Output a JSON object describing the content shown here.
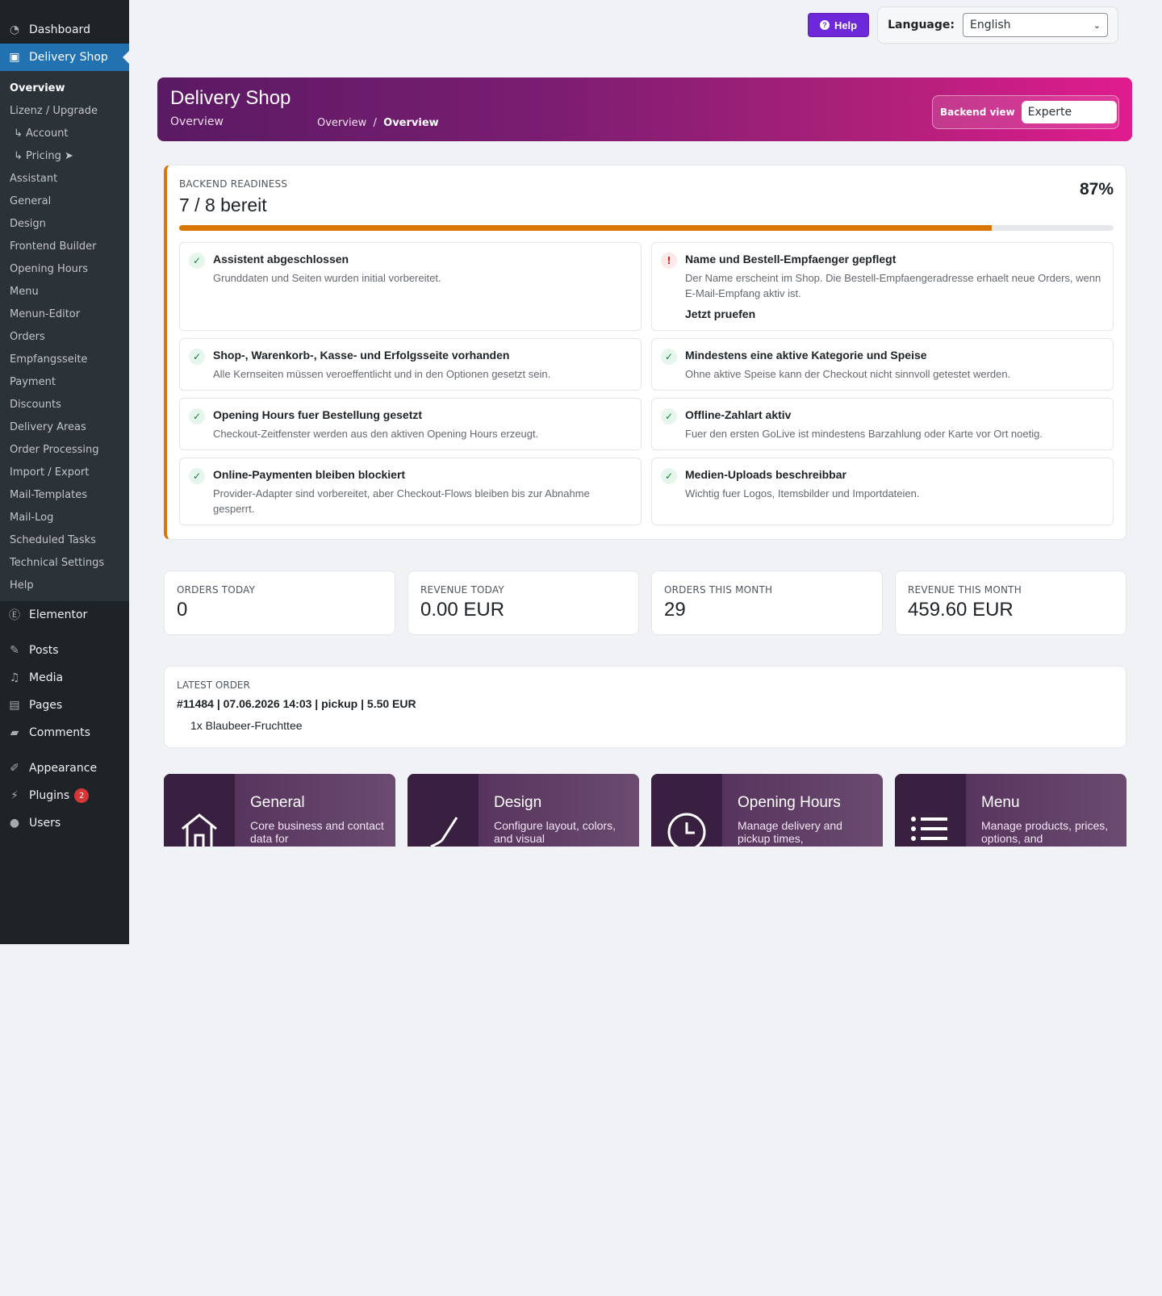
{
  "sidebar": {
    "top_items": [
      {
        "label": "Dashboard",
        "icon": "dashboard-icon"
      },
      {
        "label": "Delivery Shop",
        "icon": "shop-bag-icon"
      }
    ],
    "sub_items": [
      "Overview",
      "Lizenz / Upgrade",
      "↳ Account",
      "↳ Pricing ➤",
      "Assistant",
      "General",
      "Design",
      "Frontend Builder",
      "Opening Hours",
      "Menu",
      "Menun-Editor",
      "Orders",
      "Empfangsseite",
      "Payment",
      "Discounts",
      "Delivery Areas",
      "Order Processing",
      "Import / Export",
      "Mail-Templates",
      "Mail-Log",
      "Scheduled Tasks",
      "Technical Settings",
      "Help"
    ],
    "elementor": "Elementor",
    "posts": "Posts",
    "media": "Media",
    "pages": "Pages",
    "comments": "Comments",
    "appearance": "Appearance",
    "plugins": "Plugins",
    "plugins_badge": "2",
    "users": "Users"
  },
  "topbar": {
    "help_label": "Help",
    "language_label": "Language:",
    "language_value": "English"
  },
  "header": {
    "title": "Delivery Shop",
    "subtitle": "Overview",
    "breadcrumb_parent": "Overview",
    "breadcrumb_sep": "/",
    "breadcrumb_current": "Overview",
    "backend_view_label": "Backend view",
    "backend_view_value": "Experte"
  },
  "readiness": {
    "kicker": "BACKEND READINESS",
    "count": "7 / 8 bereit",
    "percent_label": "87%",
    "progress": 0.87,
    "accent": "#d97706",
    "checks": [
      {
        "title": "Assistent abgeschlossen",
        "desc": "Grunddaten und Seiten wurden initial vorbereitet.",
        "status": "ok"
      },
      {
        "title": "Name und Bestell-Empfaenger gepflegt",
        "desc": "Der Name erscheint im Shop. Die Bestell-Empfaengeradresse erhaelt neue Orders, wenn E-Mail-Empfang aktiv ist.",
        "link": "Jetzt pruefen",
        "status": "warn"
      },
      {
        "title": "Shop-, Warenkorb-, Kasse- und Erfolgsseite vorhanden",
        "desc": "Alle Kernseiten müssen veroeffentlicht und in den Optionen gesetzt sein.",
        "status": "ok"
      },
      {
        "title": "Mindestens eine aktive Kategorie und Speise",
        "desc": "Ohne aktive Speise kann der Checkout nicht sinnvoll getestet werden.",
        "status": "ok"
      },
      {
        "title": "Opening Hours fuer Bestellung gesetzt",
        "desc": "Checkout-Zeitfenster werden aus den aktiven Opening Hours erzeugt.",
        "status": "ok"
      },
      {
        "title": "Offline-Zahlart aktiv",
        "desc": "Fuer den ersten GoLive ist mindestens Barzahlung oder Karte vor Ort noetig.",
        "status": "ok"
      },
      {
        "title": "Online-Paymenten bleiben blockiert",
        "desc": "Provider-Adapter sind vorbereitet, aber Checkout-Flows bleiben bis zur Abnahme gesperrt.",
        "status": "ok"
      },
      {
        "title": "Medien-Uploads beschreibbar",
        "desc": "Wichtig fuer Logos, Itemsbilder und Importdateien.",
        "status": "ok"
      }
    ]
  },
  "stats": [
    {
      "label": "ORDERS TODAY",
      "value": "0"
    },
    {
      "label": "REVENUE TODAY",
      "value": "0.00 EUR"
    },
    {
      "label": "ORDERS THIS MONTH",
      "value": "29"
    },
    {
      "label": "REVENUE THIS MONTH",
      "value": "459.60 EUR"
    }
  ],
  "latest_order": {
    "kicker": "LATEST ORDER",
    "line": "#11484 | 07.06.2026 14:03 | pickup | 5.50 EUR",
    "item": "1x Blaubeer-Fruchttee"
  },
  "modules": [
    {
      "title": "General",
      "desc": "Core business and contact data for",
      "icon": "home-icon"
    },
    {
      "title": "Design",
      "desc": "Configure layout, colors, and visual",
      "icon": "brush-icon"
    },
    {
      "title": "Opening Hours",
      "desc": "Manage delivery and pickup times,",
      "icon": "clock-icon"
    },
    {
      "title": "Menu",
      "desc": "Manage products, prices, options, and",
      "icon": "list-icon"
    }
  ],
  "colors": {
    "sidebar_bg": "#1d2327",
    "sidebar_active": "#2271b1",
    "help_button": "#6d28d9",
    "header_gradient_start": "#5a1a64",
    "header_gradient_end": "#e01c8e"
  }
}
